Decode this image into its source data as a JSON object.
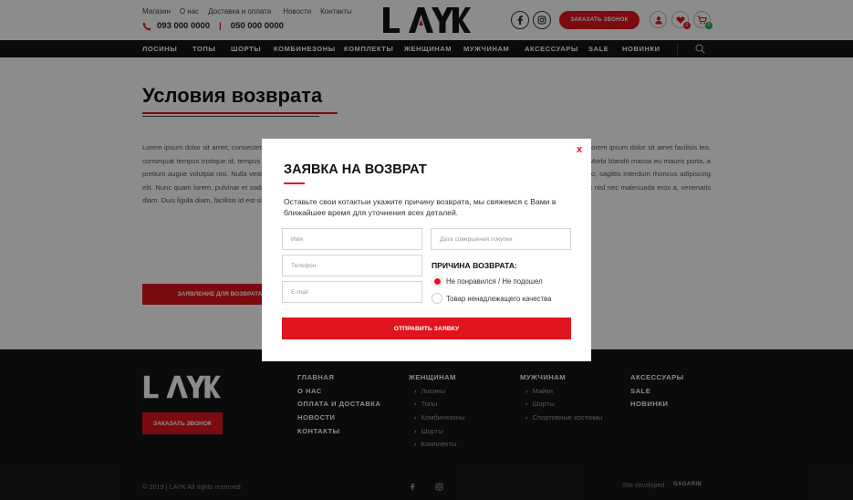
{
  "header": {
    "top_links": [
      "Магазин",
      "О нас",
      "Доставка и оплата",
      "Новости",
      "Контакты"
    ],
    "phone1": "093 000 0000",
    "phone_sep": "|",
    "phone2": "050 000 0000",
    "call_button": "ЗАКАЗАТЬ ЗВОНОК",
    "favorites_count": "0",
    "cart_count": "0"
  },
  "nav": {
    "items": [
      "ЛОСИНЫ",
      "ТОПЫ",
      "ШОРТЫ",
      "КОМБИНЕЗОНЫ",
      "КОМПЛЕКТЫ",
      "ЖЕНЩИНАМ",
      "МУЖЧИНАМ",
      "АКСЕССУАРЫ",
      "SALE",
      "НОВИНКИ"
    ]
  },
  "page": {
    "title": "Условия возврата",
    "body_text": "Lorem ipsum dolor sit amet, consectetur adipiscing elit. Pellentesque in nulla eu, lobortis gravida mauris. Nulla bibendum augue non est luctus, lorem ipsum dolor sit amet facilisis leo, consequat tempus tristique id, tempus hendrerit augue. Donec ut vulputate velit lorem vitae aliquet vivamus vitae aliquet ligula, eu mollis quam. Morbi blandit massa eu mauris porta, a pretium augue volutpat nisi. Nulla vestibulum, mauris eu placerat viverra, metus ligula hendrerit montes, nascetur ridiculus mus. Proin ante libero, sagittis interdum rhoncus adipiscing elit. Nunc quam lorem, pulvinar et sodales at, faucibus at lacus. Aenean quam. Vivamus in lacus ornare, luctus dui ac, imperdiet purus. Duis nec nisl nec malesuada eros a, venenatis diam. Duis ligula diam, facilisis id est sit amet.",
    "form_button": "ЗАЯВЛЕНИЕ ДЛЯ ВОЗВРАТА"
  },
  "modal": {
    "close": "x",
    "title": "ЗАЯВКА НА ВОЗВРАТ",
    "description": "Оставьте свои котактыи укажите причину возврата, мы свяжемся с Вами в ближайшее время для уточнения всех деталей.",
    "name_placeholder": "Имя",
    "phone_placeholder": "Телефон",
    "email_placeholder": "E-mail",
    "date_placeholder": "Дата совершения покупки",
    "reason_title": "ПРИЧИНА ВОЗВРАТА:",
    "reason_1": "Не понравился / Не подошел",
    "reason_2": "Товар ненадлежащего качества",
    "submit": "ОТПРАВИТЬ ЗАЯВКУ"
  },
  "footer": {
    "call_button": "ЗАКАЗАТЬ ЗВОНОК",
    "col1": [
      "ГЛАВНАЯ",
      "О НАС",
      "ОПЛАТА И ДОСТАВКА",
      "НОВОСТИ",
      "КОНТАКТЫ"
    ],
    "col2_title": "ЖЕНЩИНАМ",
    "col2": [
      "Лосины",
      "Топы",
      "Комбинезоны",
      "Шорты",
      "Комплекты"
    ],
    "col3_title": "МУЖЧИНАМ",
    "col3": [
      "Майки",
      "Шорты",
      "Спортивные костюмы"
    ],
    "col4": [
      "АКСЕССУАРЫ",
      "SALE",
      "НОВИНКИ"
    ],
    "copyright": "© 2019 | LAYK All rights reserved",
    "dev_label": "Site developed",
    "dev_name": "GAGARIN"
  },
  "colors": {
    "accent": "#e0141e",
    "dark": "#151515"
  }
}
